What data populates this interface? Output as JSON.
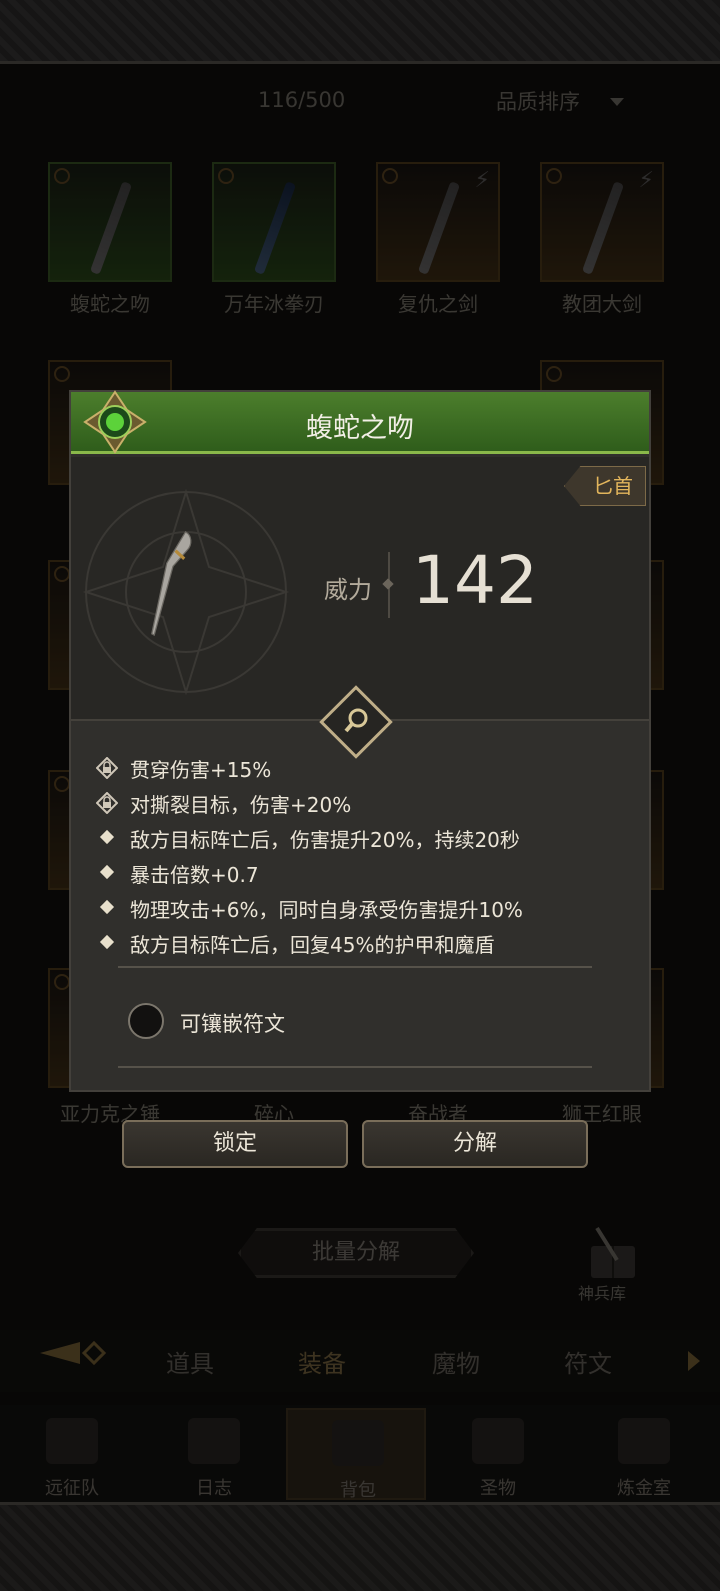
{
  "inventory": {
    "count": "116/500",
    "sort_label": "品质排序",
    "row1": [
      {
        "name": "蝮蛇之吻"
      },
      {
        "name": "万年冰拳刃"
      },
      {
        "name": "复仇之剑"
      },
      {
        "name": "教团大剑"
      }
    ],
    "row_bottom": [
      {
        "name": "亚力克之锤"
      },
      {
        "name": "碎心"
      },
      {
        "name": "奋战者"
      },
      {
        "name": "狮王红眼"
      }
    ],
    "partial_label": "者",
    "batch_button": "批量分解",
    "armory_label": "神兵库"
  },
  "tabs": [
    {
      "label": "道具"
    },
    {
      "label": "装备",
      "active": true
    },
    {
      "label": "魔物"
    },
    {
      "label": "符文"
    }
  ],
  "bottom_nav": [
    {
      "label": "远征队"
    },
    {
      "label": "日志"
    },
    {
      "label": "背包",
      "active": true
    },
    {
      "label": "圣物"
    },
    {
      "label": "炼金室"
    }
  ],
  "popup": {
    "title": "蝮蛇之吻",
    "type_tag": "匕首",
    "power_label": "威力",
    "power_value": "142",
    "attributes": [
      {
        "text": "贯穿伤害+15%",
        "locked": true
      },
      {
        "text": "对撕裂目标，伤害+20%",
        "locked": true
      },
      {
        "text": "敌方目标阵亡后，伤害提升20%，持续20秒",
        "locked": false
      },
      {
        "text": "暴击倍数+0.7",
        "locked": false
      },
      {
        "text": "物理攻击+6%，同时自身承受伤害提升10%",
        "locked": false
      },
      {
        "text": "敌方目标阵亡后，回复45%的护甲和魔盾",
        "locked": false
      }
    ],
    "rune_label": "可镶嵌符文",
    "lock_button": "锁定",
    "decompose_button": "分解"
  },
  "colors": {
    "header_green": "#4c7e2c",
    "accent_gold": "#e2b55c",
    "panel": "#302f2c"
  }
}
